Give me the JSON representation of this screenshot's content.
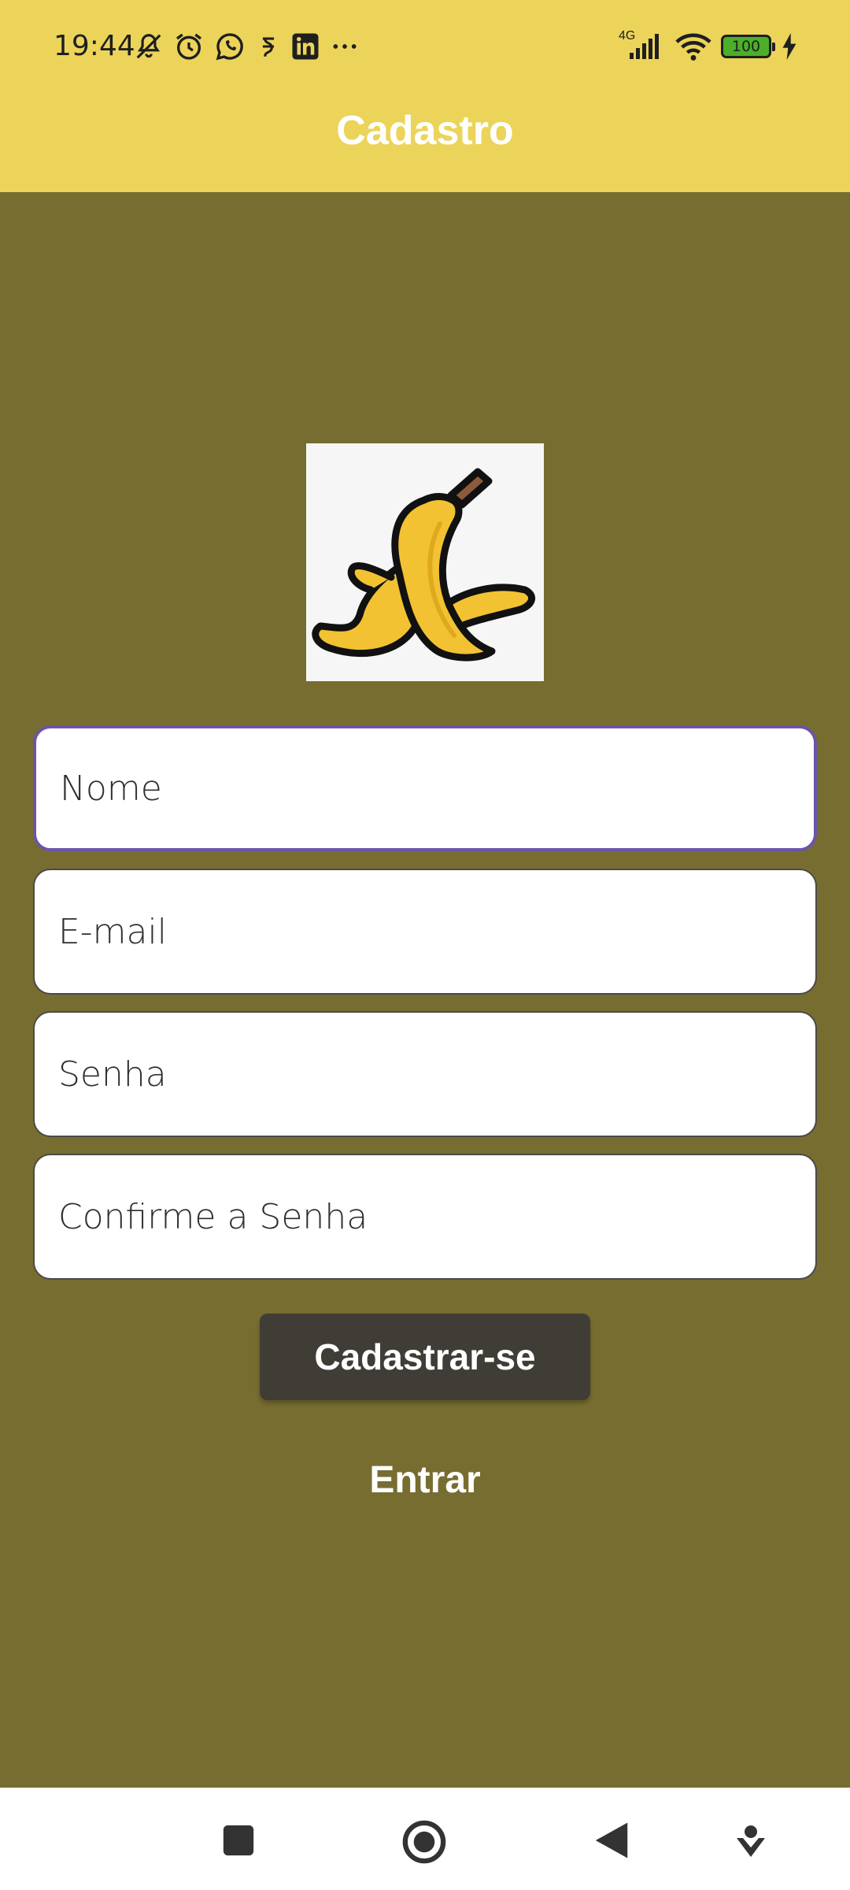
{
  "status_bar": {
    "time": "19:44",
    "network_type": "4G",
    "battery_level": "100",
    "left_icons": [
      "bell-off-icon",
      "alarm-icon",
      "whatsapp-icon",
      "app-icon",
      "linkedin-icon",
      "more-icon"
    ],
    "right_icons": [
      "signal-icon",
      "wifi-icon",
      "battery-icon",
      "charging-icon"
    ]
  },
  "header": {
    "title": "Cadastro",
    "color": "#ecd45a"
  },
  "logo": {
    "icon": "banana-peel-icon"
  },
  "form": {
    "name_placeholder": "Nome",
    "email_placeholder": "E-mail",
    "password_placeholder": "Senha",
    "confirm_password_placeholder": "Confirme a Senha",
    "register_label": "Cadastrar-se",
    "login_label": "Entrar"
  },
  "nav": {
    "icons": [
      "square-icon",
      "home-circle-icon",
      "back-triangle-icon",
      "assistant-icon"
    ]
  },
  "colors": {
    "background": "#786d30",
    "focus_border": "#6a55a8",
    "button": "#403d37"
  }
}
